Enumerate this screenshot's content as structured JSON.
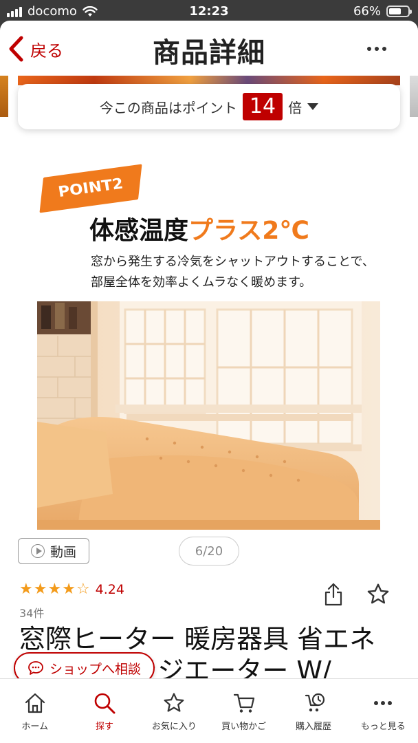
{
  "status": {
    "carrier": "docomo",
    "time": "12:23",
    "battery": "66%",
    "battery_level": 0.66
  },
  "header": {
    "back_label": "戻る",
    "title": "商品詳細"
  },
  "points": {
    "prefix": "今この商品はポイント",
    "multiplier": "14",
    "suffix": "倍"
  },
  "feature": {
    "badge": "POINT2",
    "heading_main": "体感温度",
    "heading_accent": "プラス2℃",
    "desc_line1": "窓から発生する冷気をシャットアウトすることで、",
    "desc_line2": "部屋全体を効率よくムラなく暖めます。"
  },
  "gallery": {
    "video_label": "動画",
    "pager": "6/20"
  },
  "rating": {
    "stars": 4.24,
    "value": "4.24",
    "count": "34件"
  },
  "product": {
    "title_line1": "窓際ヒーター 暖房器具 省エネ",
    "title_line2": "ヒーター ラジエーター W/"
  },
  "consult": {
    "label": "ショップへ相談"
  },
  "nav": [
    {
      "label": "ホーム",
      "icon": "home-icon"
    },
    {
      "label": "探す",
      "icon": "search-icon"
    },
    {
      "label": "お気に入り",
      "icon": "star-icon"
    },
    {
      "label": "買い物かご",
      "icon": "cart-icon"
    },
    {
      "label": "購入履歴",
      "icon": "history-icon"
    },
    {
      "label": "もっと見る",
      "icon": "more-icon"
    }
  ],
  "colors": {
    "brand": "#bf0000",
    "accent": "#f07a1c",
    "star": "#f39b1b"
  }
}
